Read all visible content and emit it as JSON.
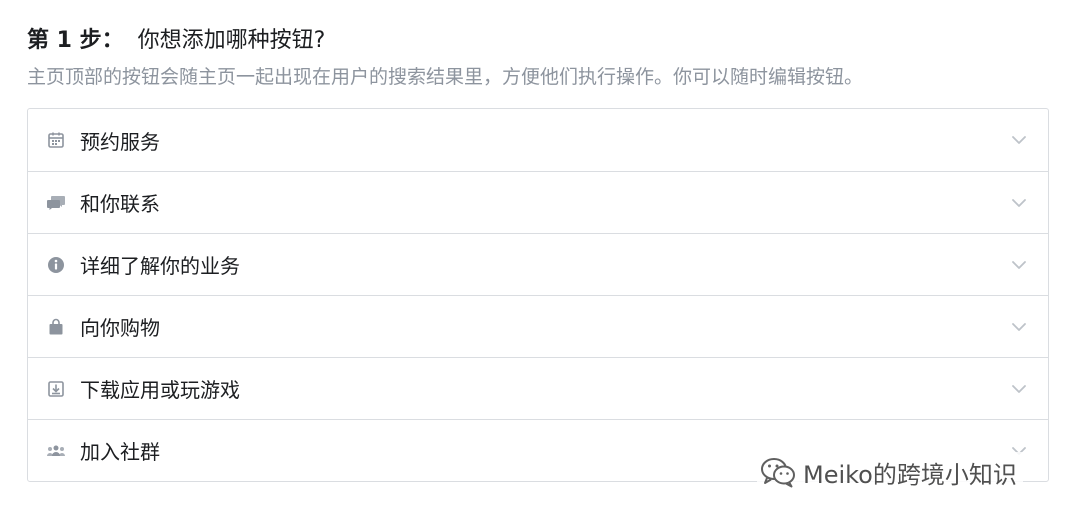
{
  "header": {
    "step_label": "第 1 步：",
    "question": "你想添加哪种按钮?",
    "description": "主页顶部的按钮会随主页一起出现在用户的搜索结果里，方便他们执行操作。你可以随时编辑按钮。"
  },
  "options": [
    {
      "label": "预约服务",
      "icon": "calendar-icon"
    },
    {
      "label": "和你联系",
      "icon": "chat-bubbles-icon"
    },
    {
      "label": "详细了解你的业务",
      "icon": "info-icon"
    },
    {
      "label": "向你购物",
      "icon": "shopping-bag-icon"
    },
    {
      "label": "下载应用或玩游戏",
      "icon": "download-icon"
    },
    {
      "label": "加入社群",
      "icon": "community-icon"
    }
  ],
  "watermark": {
    "text": "Meiko的跨境小知识",
    "icon": "wechat-icon"
  },
  "colors": {
    "text_primary": "#1c1e21",
    "text_secondary": "#8d949e",
    "border": "#dadde1",
    "icon": "#8d949e"
  }
}
